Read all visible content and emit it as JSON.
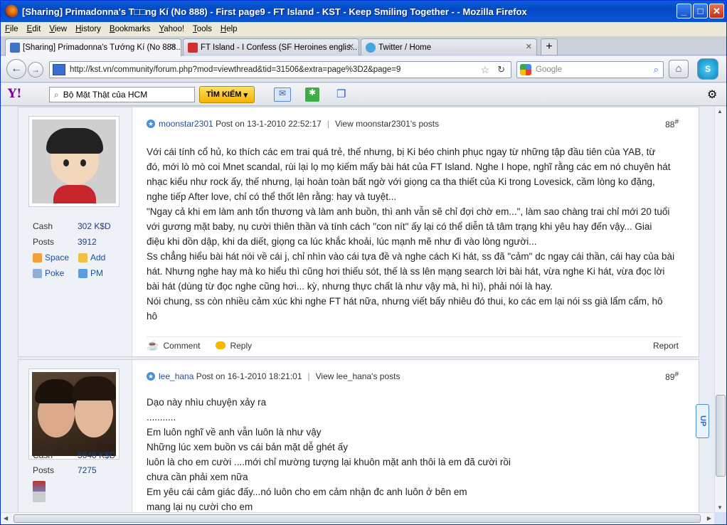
{
  "window": {
    "title": "[Sharing] Primadonna's T□□ng Kí (No 888) - First page9 - FT Island - KST - Keep Smiling Together - - Mozilla Firefox",
    "min": "_",
    "max": "□",
    "close": "✕"
  },
  "menu": [
    "File",
    "Edit",
    "View",
    "History",
    "Bookmarks",
    "Yahoo!",
    "Tools",
    "Help"
  ],
  "tabs": [
    {
      "label": "[Sharing] Primadonna's Tướng Kí (No 888...",
      "color": "#3f74c9"
    },
    {
      "label": "FT Island - I Confess (SF Heroines englis...",
      "color": "#d32f2f"
    },
    {
      "label": "Twitter / Home",
      "color": "#4aa3df"
    }
  ],
  "nav": {
    "url": "http://kst.vn/community/forum.php?mod=viewthread&tid=31506&extra=page%3D2&page=9",
    "search_placeholder": "Google"
  },
  "yahoo": {
    "logo": "Y!",
    "query": "Bộ Mặt Thật của HCM",
    "button": "TÌM KIẾM"
  },
  "posts": [
    {
      "user": "moonstar2301",
      "meta": "Post on 13-1-2010 22:52:17",
      "view": "View moonstar2301's posts",
      "number": "88",
      "sup": "#",
      "cash_label": "Cash",
      "cash": "302 K$D",
      "posts_label": "Posts",
      "posts": "3912",
      "space": "Space",
      "add": "Add",
      "poke": "Poke",
      "pm": "PM",
      "lines": [
        "Với cái tính cổ hủ, ko thích các em trai quá trẻ, thế nhưng, bị Ki béo chinh phục ngay từ những tập đầu tiên của YAB, từ",
        "đó, mới lò mò coi Mnet scandal, rùi lại lọ mọ kiếm mấy bài hát của FT Island. Nghe I hope, nghĩ rằng các em nó chuyên hát",
        "nhạc kiểu như rock ấy, thế nhưng, lại hoàn toàn bất ngờ với giọng ca tha thiết của Ki trong Lovesick, cầm lòng ko đặng,",
        "nghe tiếp After love, chỉ có thể thốt lên rằng: hay và tuyệt...",
        "\"Ngay cả khi em làm anh tổn thương và làm anh buồn, thì anh vẫn sẽ chỉ đợi chờ em...\", làm sao chàng trai chỉ mới 20 tuổi",
        "với gương mặt baby, nụ cười thiên thần và tính cách \"con nít\" ấy lại có thể diễn tả tâm trạng khi yêu hay đến vậy... Giai",
        "điệu khi dồn dập, khi da diết, giọng ca lúc khắc khoải, lúc mạnh mẽ như đi vào lòng người...",
        "Ss chẳng hiểu bài hát nói về cái j, chỉ nhìn vào cái tựa đề và nghe cách Ki hát, ss đã \"cảm\" dc ngay cái thần, cái hay của bài",
        "hát. Nhưng nghe hay mà ko hiểu thì cũng hơi thiếu sót, thế là ss lên mạng search lời bài hát, vừa nghe Ki hát, vừa đọc lời",
        "bài hát (dùng từ đọc nghe cũng hơi... kỳ, nhưng thực chất là như vậy mà, hì hì), phải nói là hay.",
        "Nói chung, ss còn nhiều cảm xúc khi nghe FT hát nữa, nhưng viết bấy nhiêu đó thui, ko các em lại nói ss già lẩm cẩm, hô",
        "hô"
      ],
      "comment": "Comment",
      "reply": "Reply",
      "report": "Report"
    },
    {
      "user": "lee_hana",
      "meta": "Post on 16-1-2010 18:21:01",
      "view": "View lee_hana's posts",
      "number": "89",
      "sup": "#",
      "cash_label": "Cash",
      "cash": "5648 K$D",
      "posts_label": "Posts",
      "posts": "7275",
      "lines": [
        "Dạo này nhìu chuyện xảy ra",
        "...........",
        "Em luôn nghĩ về anh vẫn luôn là như vậy",
        "Những lúc xem buồn vs cái bản mặt dễ ghét ấy",
        "luôn là cho em cười ....mới chỉ mường tượng lại khuôn mặt anh thôi là em đã cười rồi",
        "chưa cần phải xem nữa",
        "Em yêu cái cảm giác đấy...nó luôn cho em cảm nhận đc anh luôn ở bên em",
        "mang lại nụ cười cho em"
      ]
    }
  ],
  "upbutton": "UP"
}
